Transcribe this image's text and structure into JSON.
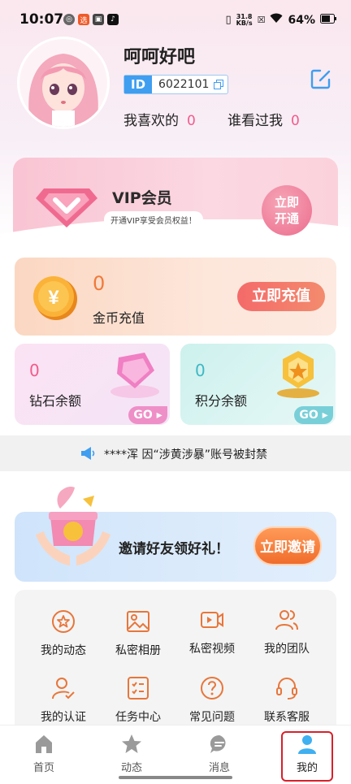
{
  "status_bar": {
    "time": "10:07",
    "net_speed_value": "31.8",
    "net_speed_unit": "KB/s",
    "battery": "64%"
  },
  "profile": {
    "username": "呵呵好吧",
    "id_label": "ID",
    "id_value": "6022101",
    "likes_label": "我喜欢的",
    "likes_count": "0",
    "visitors_label": "谁看过我",
    "visitors_count": "0"
  },
  "vip": {
    "title": "VIP会员",
    "subtitle": "开通VIP享受会员权益！",
    "button_line1": "立即",
    "button_line2": "开通"
  },
  "coins": {
    "amount": "0",
    "label": "金币充值",
    "button": "立即充值"
  },
  "diamonds": {
    "amount": "0",
    "label": "钻石余额",
    "go": "GO"
  },
  "points": {
    "amount": "0",
    "label": "积分余额",
    "go": "GO"
  },
  "notice": {
    "text": "****浑 因“涉黄涉暴”账号被封禁"
  },
  "invite": {
    "text": "邀请好友领好礼！",
    "button": "立即邀请"
  },
  "menu": [
    {
      "label": "我的动态",
      "icon": "star-circle-icon"
    },
    {
      "label": "私密相册",
      "icon": "image-icon"
    },
    {
      "label": "私密视频",
      "icon": "video-icon"
    },
    {
      "label": "我的团队",
      "icon": "team-icon"
    },
    {
      "label": "我的认证",
      "icon": "user-check-icon"
    },
    {
      "label": "任务中心",
      "icon": "task-list-icon"
    },
    {
      "label": "常见问题",
      "icon": "question-icon"
    },
    {
      "label": "联系客服",
      "icon": "headset-icon"
    }
  ],
  "tabs": [
    {
      "label": "首页",
      "icon": "home-icon"
    },
    {
      "label": "动态",
      "icon": "star-icon"
    },
    {
      "label": "消息",
      "icon": "message-icon"
    },
    {
      "label": "我的",
      "icon": "person-icon",
      "active": true
    }
  ],
  "colors": {
    "accent_pink": "#f25b8b",
    "accent_blue": "#3f9ef0",
    "accent_orange": "#f07a3a",
    "teal": "#3fb8c4",
    "highlight_red": "#d8202a"
  }
}
